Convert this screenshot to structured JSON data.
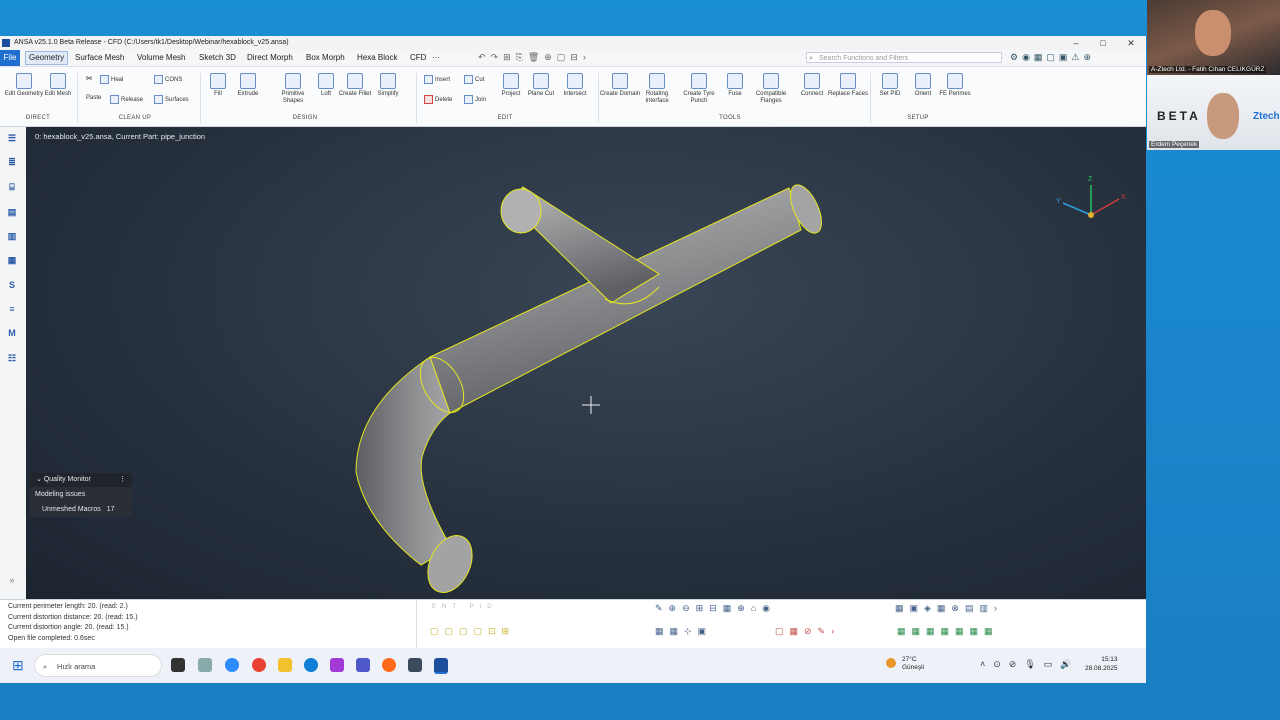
{
  "window": {
    "title": "ANSA v25.1.0 Beta Release - CFD (C:/Users/tk1/Desktop/Webinar/hexablock_v25.ansa)",
    "minimize": "–",
    "maximize": "□",
    "close": "✕"
  },
  "menu": [
    "File",
    "Geometry",
    "Surface Mesh",
    "Volume Mesh",
    "Sketch 3D",
    "Direct Morph",
    "Box Morph",
    "Hexa Block",
    "CFD",
    "···"
  ],
  "search": {
    "placeholder": "Search Functions and Filters"
  },
  "ribbon": {
    "direct": {
      "label": "DIRECT",
      "items": [
        "Edit Geometry",
        "Edit Mesh"
      ]
    },
    "cleanup": {
      "label": "CLEAN UP",
      "col1": [
        "Heal",
        "Release"
      ],
      "col2": [
        "CONS",
        "Surfaces"
      ],
      "paste": "Paste"
    },
    "design": {
      "label": "DESIGN",
      "items": [
        "Fill",
        "Extrude",
        "Primitive Shapes",
        "Loft",
        "Create Fillet",
        "Simplify"
      ]
    },
    "edit": {
      "label": "EDIT",
      "small": [
        "Insert",
        "Delete",
        "Cut",
        "Join"
      ],
      "items": [
        "Project",
        "Plane Cut",
        "Intersect"
      ]
    },
    "tools": {
      "label": "TOOLS",
      "items": [
        "Create Domain",
        "Rotating Interface",
        "Create Tyre Punch",
        "Fuse",
        "Compatible Flanges",
        "Connect",
        "Replace Faces"
      ]
    },
    "setup": {
      "label": "SETUP",
      "items": [
        "Set PID",
        "Orient",
        "FE Perimes"
      ]
    }
  },
  "viewport": {
    "info": "0: hexablock_v25.ansa,  Current Part: pipe_junction",
    "axes": {
      "x": "X",
      "y": "Y",
      "z": "Z"
    }
  },
  "quality_monitor": {
    "title": "Quality Monitor",
    "modeling_issues": "Modeling issues",
    "unmeshed_label": "Unmeshed Macros",
    "unmeshed_count": "17"
  },
  "log": [
    "Current perimeter length: 20. (read: 2.)",
    "Current distortion distance: 20. (read: 15.)",
    "Current distortion angle: 20. (read: 15.)",
    "Open file completed: 0.6sec"
  ],
  "statusbar": {
    "ent": "ENT",
    "pid": "PID"
  },
  "taskbar": {
    "search_placeholder": "Hızlı arama",
    "weather_temp": "27°C",
    "weather_desc": "Güneşli",
    "time": "15:13",
    "date": "28.08.2025"
  },
  "webcams": [
    {
      "label": "A-Ztech Ltd. - Fatih Cihan CELIKGÜRZ"
    },
    {
      "label": "Erdem Peçenek",
      "brand": "BETA",
      "brand2": "Ztech"
    }
  ],
  "colors": {
    "accent": "#1f6fd1",
    "edge": "#e5e621",
    "viewport": "#28323f"
  }
}
